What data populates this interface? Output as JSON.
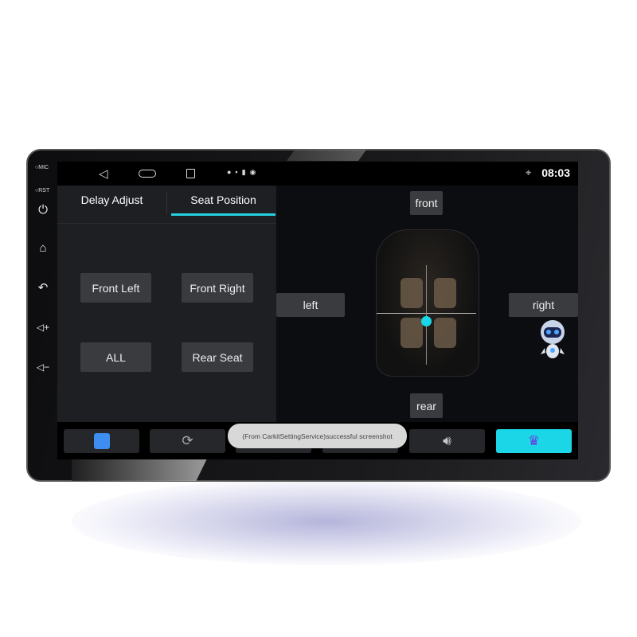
{
  "side_panel": {
    "mic_label": "MIC",
    "rst_label": "RST"
  },
  "status_bar": {
    "time": "08:03"
  },
  "tabs": [
    {
      "label": "Delay Adjust",
      "active": false
    },
    {
      "label": "Seat Position",
      "active": true
    }
  ],
  "seat_buttons": {
    "front_left": "Front Left",
    "front_right": "Front Right",
    "all": "ALL",
    "rear_seat": "Rear Seat"
  },
  "direction_buttons": {
    "front": "front",
    "left": "left",
    "right": "right",
    "rear": "rear"
  },
  "toast": "(From CarkitSettingService)successful screenshot",
  "colors": {
    "accent": "#25d0e0",
    "crown_button": "#1ad6e6"
  }
}
